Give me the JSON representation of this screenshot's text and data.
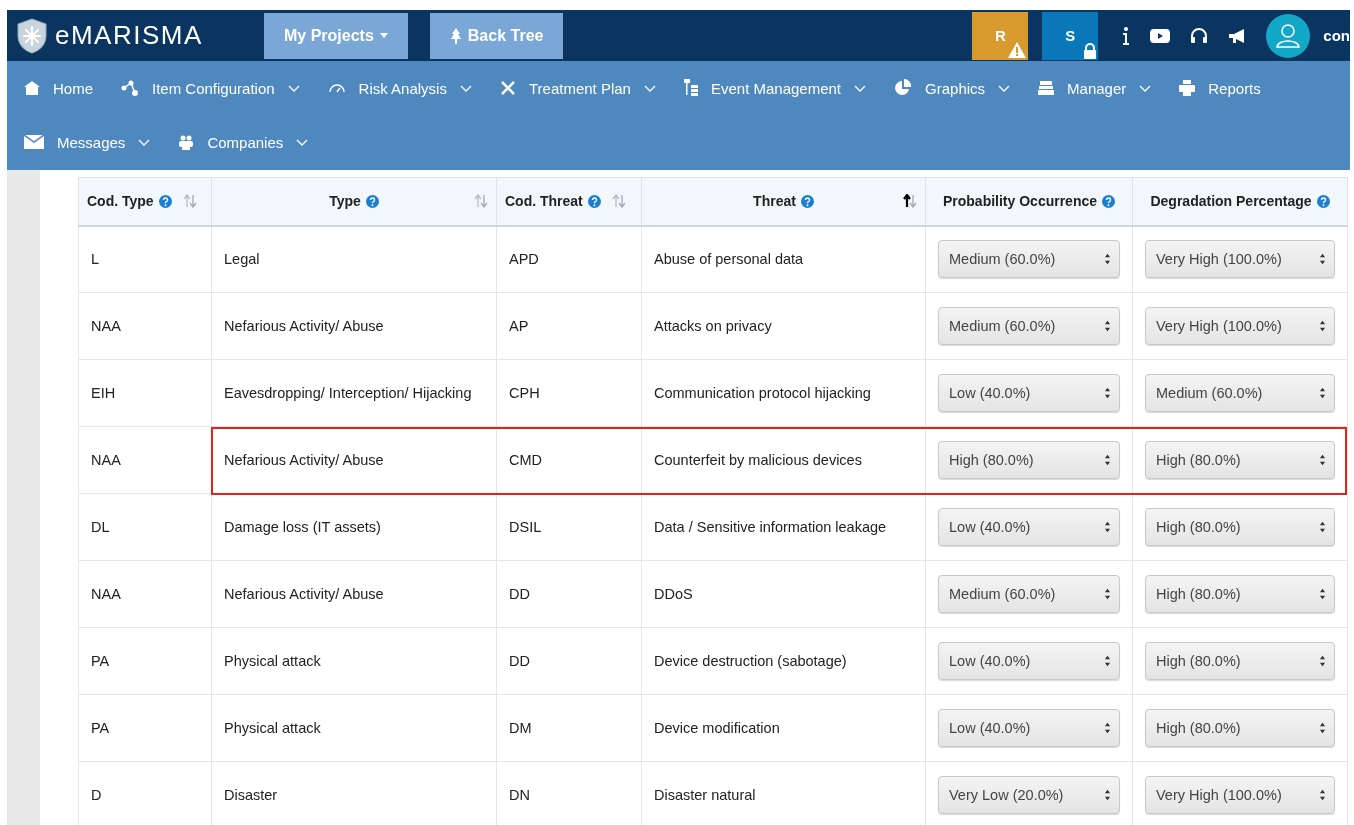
{
  "header": {
    "logo": "eMARISMA",
    "buttons": [
      {
        "label": "My Projects",
        "dropdown": true
      },
      {
        "label": "Back Tree",
        "dropdown": false
      }
    ],
    "badges": [
      {
        "label": "R",
        "kind": "warning",
        "color": "#d89a2f"
      },
      {
        "label": "S",
        "kind": "locked",
        "color": "#0a78b8"
      }
    ],
    "user": "con"
  },
  "nav": {
    "rows": [
      [
        {
          "label": "Home",
          "dropdown": false
        },
        {
          "label": "Item Configuration",
          "dropdown": true
        },
        {
          "label": "Risk Analysis",
          "dropdown": true
        },
        {
          "label": "Treatment Plan",
          "dropdown": true
        },
        {
          "label": "Event Management",
          "dropdown": true
        },
        {
          "label": "Graphics",
          "dropdown": true
        },
        {
          "label": "Manager",
          "dropdown": true
        },
        {
          "label": "Reports",
          "dropdown": false
        }
      ],
      [
        {
          "label": "Messages",
          "dropdown": true
        },
        {
          "label": "Companies",
          "dropdown": true
        }
      ]
    ]
  },
  "table": {
    "columns": [
      {
        "label": "Cod. Type",
        "sortable": true,
        "sorted": false
      },
      {
        "label": "Type",
        "sortable": true,
        "sorted": false
      },
      {
        "label": "Cod. Threat",
        "sortable": true,
        "sorted": false
      },
      {
        "label": "Threat",
        "sortable": true,
        "sorted": true
      },
      {
        "label": "Probability Occurrence",
        "sortable": false
      },
      {
        "label": "Degradation Percentage",
        "sortable": false
      }
    ],
    "rows": [
      {
        "cod_type": "L",
        "type": "Legal",
        "cod_threat": "APD",
        "threat": "Abuse of personal data",
        "probability": "Medium (60.0%)",
        "degradation": "Very High (100.0%)",
        "highlighted": false
      },
      {
        "cod_type": "NAA",
        "type": "Nefarious Activity/ Abuse",
        "cod_threat": "AP",
        "threat": "Attacks on privacy",
        "probability": "Medium (60.0%)",
        "degradation": "Very High (100.0%)",
        "highlighted": false
      },
      {
        "cod_type": "EIH",
        "type": "Eavesdropping/ Interception/ Hijacking",
        "cod_threat": "CPH",
        "threat": "Communication protocol hijacking",
        "probability": "Low (40.0%)",
        "degradation": "Medium (60.0%)",
        "highlighted": false
      },
      {
        "cod_type": "NAA",
        "type": "Nefarious Activity/ Abuse",
        "cod_threat": "CMD",
        "threat": "Counterfeit by malicious devices",
        "probability": "High (80.0%)",
        "degradation": "High (80.0%)",
        "highlighted": true
      },
      {
        "cod_type": "DL",
        "type": "Damage loss (IT assets)",
        "cod_threat": "DSIL",
        "threat": "Data / Sensitive information leakage",
        "probability": "Low (40.0%)",
        "degradation": "High (80.0%)",
        "highlighted": false
      },
      {
        "cod_type": "NAA",
        "type": "Nefarious Activity/ Abuse",
        "cod_threat": "DD",
        "threat": "DDoS",
        "probability": "Medium (60.0%)",
        "degradation": "High (80.0%)",
        "highlighted": false
      },
      {
        "cod_type": "PA",
        "type": "Physical attack",
        "cod_threat": "DD",
        "threat": "Device destruction (sabotage)",
        "probability": "Low (40.0%)",
        "degradation": "High (80.0%)",
        "highlighted": false
      },
      {
        "cod_type": "PA",
        "type": "Physical attack",
        "cod_threat": "DM",
        "threat": "Device modification",
        "probability": "Low (40.0%)",
        "degradation": "High (80.0%)",
        "highlighted": false
      },
      {
        "cod_type": "D",
        "type": "Disaster",
        "cod_threat": "DN",
        "threat": "Disaster natural",
        "probability": "Very Low (20.0%)",
        "degradation": "Very High (100.0%)",
        "highlighted": false
      }
    ]
  }
}
